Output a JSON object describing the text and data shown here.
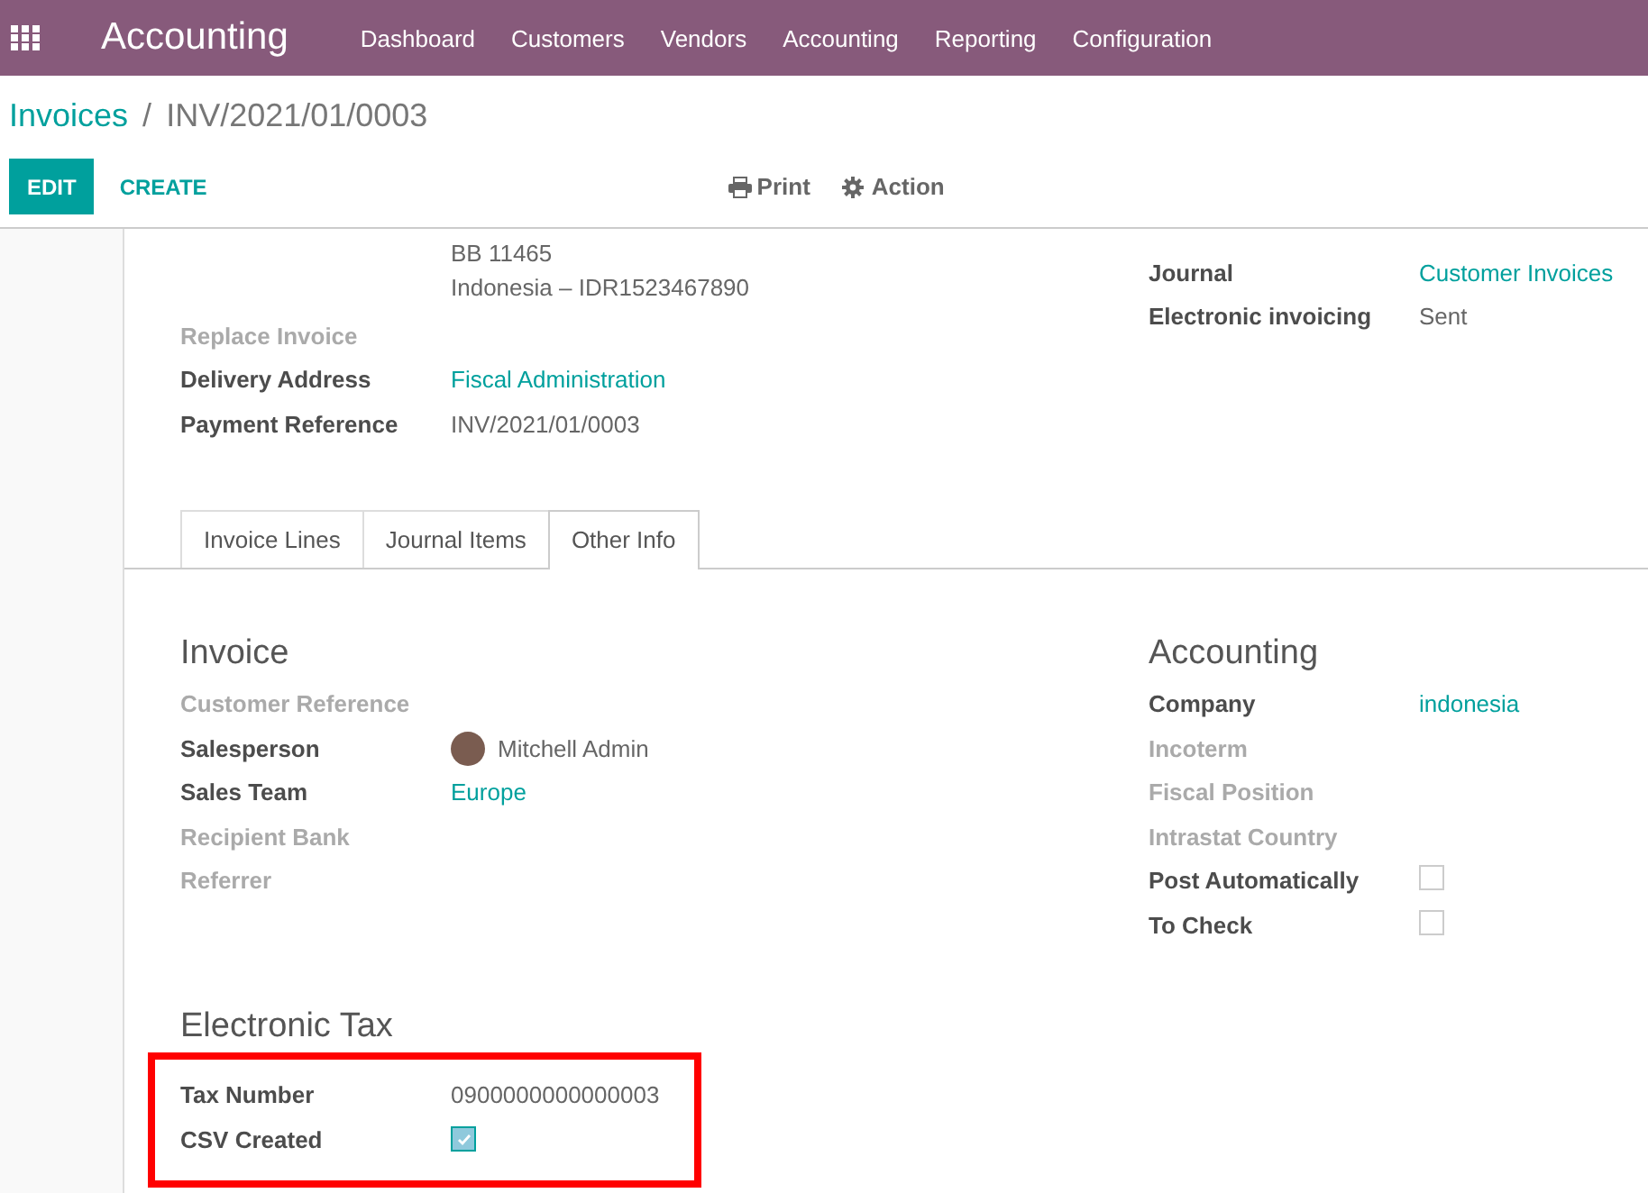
{
  "app": {
    "title": "Accounting"
  },
  "menu": [
    "Dashboard",
    "Customers",
    "Vendors",
    "Accounting",
    "Reporting",
    "Configuration"
  ],
  "breadcrumb": {
    "parent": "Invoices",
    "separator": "/",
    "current": "INV/2021/01/0003"
  },
  "buttons": {
    "edit": "EDIT",
    "create": "CREATE"
  },
  "actions": [
    {
      "label": "Print"
    },
    {
      "label": "Action"
    }
  ],
  "address_lines": [
    "BB 11465",
    "Indonesia – IDR1523467890"
  ],
  "left_fields": [
    {
      "kind": "empty",
      "label": "Replace Invoice"
    },
    {
      "kind": "link",
      "label": "Delivery Address",
      "value": "Fiscal Administration"
    },
    {
      "kind": "text",
      "label": "Payment Reference",
      "value": "INV/2021/01/0003"
    }
  ],
  "right_fields": [
    {
      "kind": "link",
      "label": "Journal",
      "value": "Customer Invoices"
    },
    {
      "kind": "text",
      "label": "Electronic invoicing",
      "value": "Sent"
    }
  ],
  "tabs": [
    {
      "label": "Invoice Lines",
      "selected": false
    },
    {
      "label": "Journal Items",
      "selected": false
    },
    {
      "label": "Other Info",
      "selected": true
    }
  ],
  "sections": [
    {
      "title": "Invoice",
      "highlighted": false,
      "fields": [
        {
          "kind": "empty",
          "label": "Customer Reference"
        },
        {
          "kind": "user",
          "label": "Salesperson",
          "value": "Mitchell Admin"
        },
        {
          "kind": "link",
          "label": "Sales Team",
          "value": "Europe"
        },
        {
          "kind": "empty",
          "label": "Recipient Bank"
        },
        {
          "kind": "empty",
          "label": "Referrer"
        }
      ]
    },
    {
      "title": "Accounting",
      "highlighted": false,
      "fields": [
        {
          "kind": "link",
          "label": "Company",
          "value": "indonesia"
        },
        {
          "kind": "empty",
          "label": "Incoterm"
        },
        {
          "kind": "empty",
          "label": "Fiscal Position"
        },
        {
          "kind": "empty",
          "label": "Intrastat Country"
        },
        {
          "kind": "checkbox",
          "label": "Post Automatically",
          "checked": false
        },
        {
          "kind": "checkbox",
          "label": "To Check",
          "checked": false
        }
      ]
    },
    {
      "title": "Electronic Tax",
      "highlighted": true,
      "fields": [
        {
          "kind": "text",
          "label": "Tax Number",
          "value": "0900000000000003"
        },
        {
          "kind": "checkbox",
          "label": "CSV Created",
          "checked": true
        }
      ]
    }
  ]
}
